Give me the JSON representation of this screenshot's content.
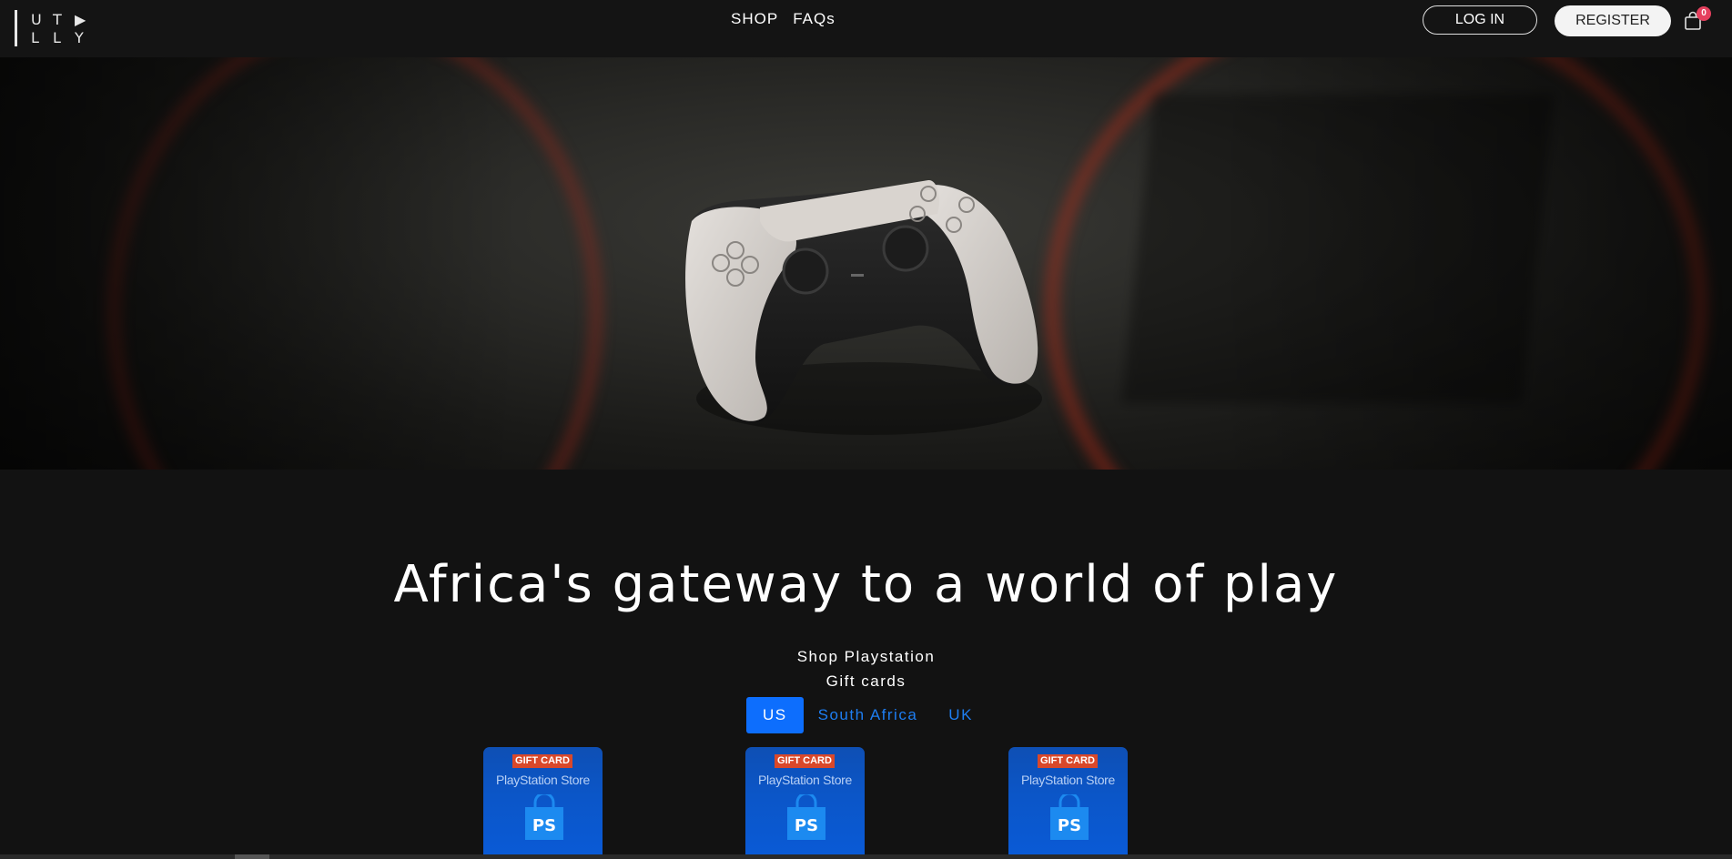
{
  "logo": {
    "letters": [
      "U",
      "T",
      "▶",
      "L",
      "L",
      "Y"
    ]
  },
  "nav": {
    "links": [
      "SHOP",
      "FAQs"
    ],
    "login": "LOG IN",
    "register": "REGISTER",
    "cart_count": "0"
  },
  "hero": {
    "subject": "controller"
  },
  "main": {
    "headline": "Africa's gateway to a world of play",
    "subtitle_line1": "Shop Playstation",
    "subtitle_line2": "Gift cards",
    "tabs": [
      {
        "label": "US",
        "active": true
      },
      {
        "label": "South Africa",
        "active": false
      },
      {
        "label": "UK",
        "active": false
      }
    ]
  },
  "cards": [
    {
      "tag": "GIFT CARD",
      "store": "PlayStation Store"
    },
    {
      "tag": "GIFT CARD",
      "store": "PlayStation Store"
    },
    {
      "tag": "GIFT CARD",
      "store": "PlayStation Store"
    }
  ],
  "colors": {
    "accent": "#0d6efd",
    "badge": "#e5405e",
    "card_tag": "#d9482a",
    "card_bg": "#0b56c8"
  }
}
